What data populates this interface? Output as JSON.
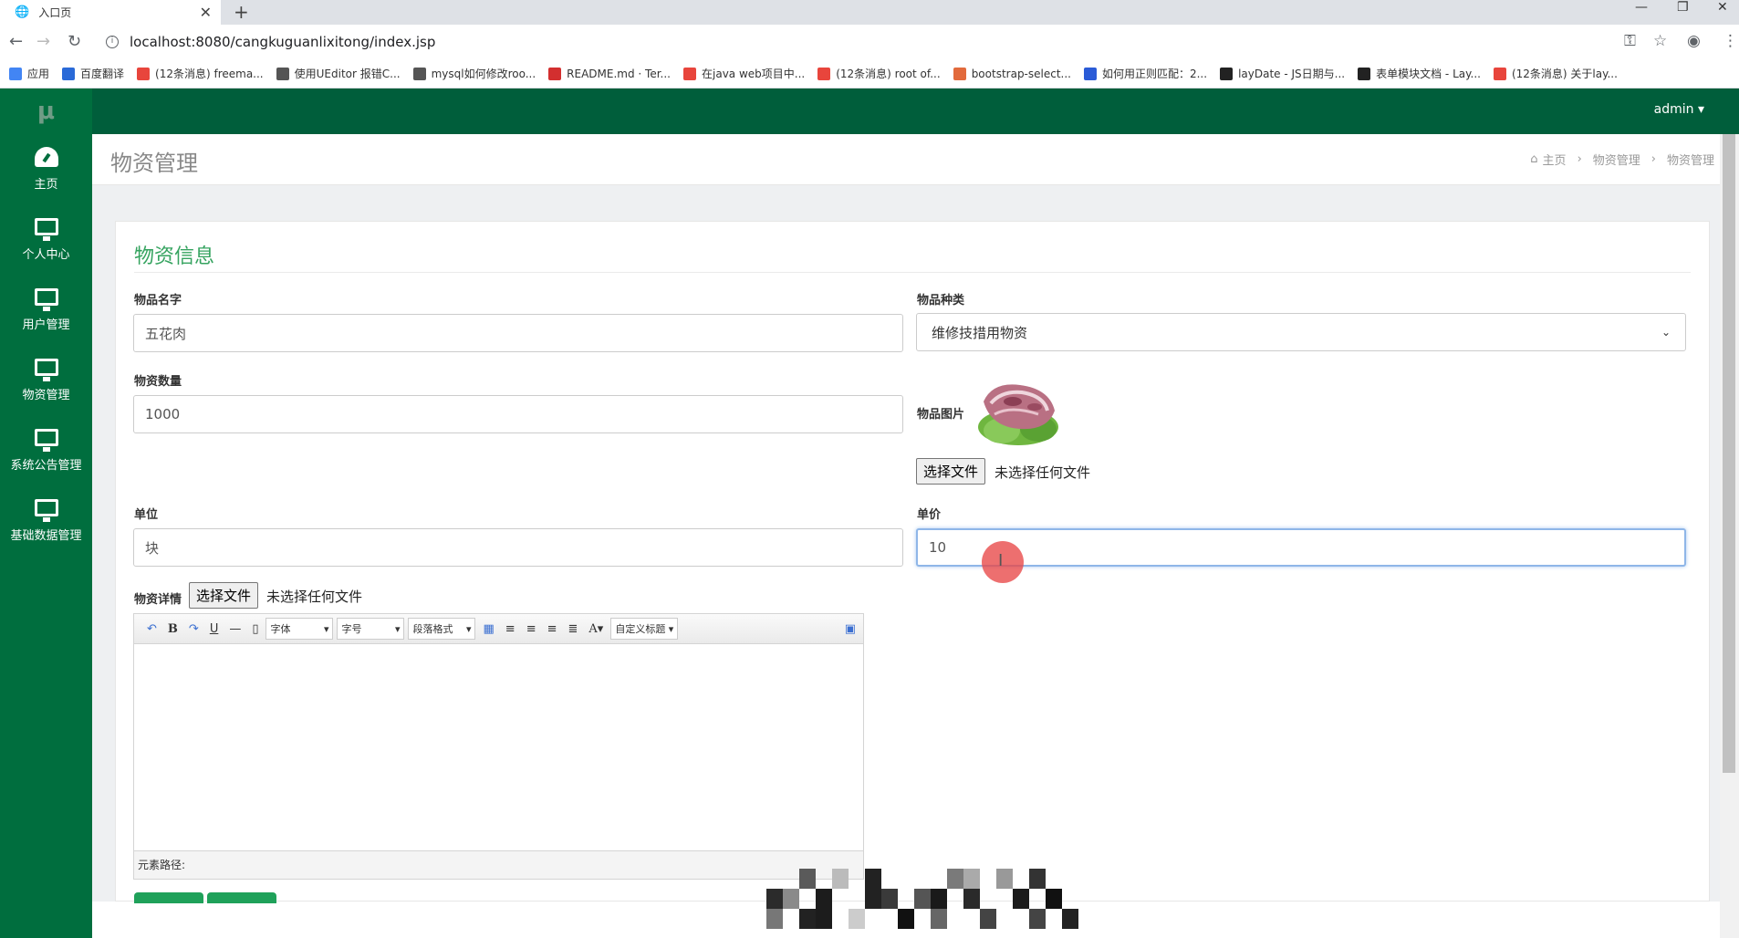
{
  "browser": {
    "tab_title": "入口页",
    "url": "localhost:8080/cangkuguanlixitong/index.jsp",
    "bookmarks": [
      {
        "label": "应用",
        "color": "#4285f4"
      },
      {
        "label": "百度翻译",
        "color": "#2a6ad8"
      },
      {
        "label": "(12条消息) freema...",
        "color": "#e8453c"
      },
      {
        "label": "使用UEditor 报错C...",
        "color": "#555555"
      },
      {
        "label": "mysql如何修改roo...",
        "color": "#555555"
      },
      {
        "label": "README.md · Ter...",
        "color": "#d32f2f"
      },
      {
        "label": "在java web项目中...",
        "color": "#e8453c"
      },
      {
        "label": "(12条消息) root of...",
        "color": "#e8453c"
      },
      {
        "label": "bootstrap-select...",
        "color": "#e26a3c"
      },
      {
        "label": "如何用正则匹配：2...",
        "color": "#2a5bd7"
      },
      {
        "label": "layDate - JS日期与...",
        "color": "#222222"
      },
      {
        "label": "表单模块文档 - Lay...",
        "color": "#222222"
      },
      {
        "label": "(12条消息) 关于lay...",
        "color": "#e8453c"
      }
    ]
  },
  "app": {
    "logo": "μ",
    "user": "admin ▾",
    "sidebar": [
      {
        "label": "主页",
        "icon": "dashboard-icon"
      },
      {
        "label": "个人中心",
        "icon": "monitor-icon"
      },
      {
        "label": "用户管理",
        "icon": "monitor-icon"
      },
      {
        "label": "物资管理",
        "icon": "monitor-icon"
      },
      {
        "label": "系统公告管理",
        "icon": "monitor-icon"
      },
      {
        "label": "基础数据管理",
        "icon": "monitor-icon"
      }
    ],
    "page_title": "物资管理",
    "breadcrumb": [
      "主页",
      "物资管理",
      "物资管理"
    ]
  },
  "form": {
    "title": "物资信息",
    "name_label": "物品名字",
    "name_value": "五花肉",
    "category_label": "物品种类",
    "category_value": "维修技措用物资",
    "quantity_label": "物资数量",
    "quantity_value": "1000",
    "image_label": "物品图片",
    "file_button": "选择文件",
    "file_none": "未选择任何文件",
    "unit_label": "单位",
    "unit_value": "块",
    "price_label": "单价",
    "price_value": "10",
    "detail_label": "物资详情",
    "editor": {
      "font": "字体",
      "size": "字号",
      "para": "段落格式",
      "custom": "自定义标题",
      "status": "元素路径:"
    }
  },
  "colors": {
    "sidebar": "#006e3e",
    "topbar": "#005e3b",
    "accent_title": "#35a35f"
  }
}
